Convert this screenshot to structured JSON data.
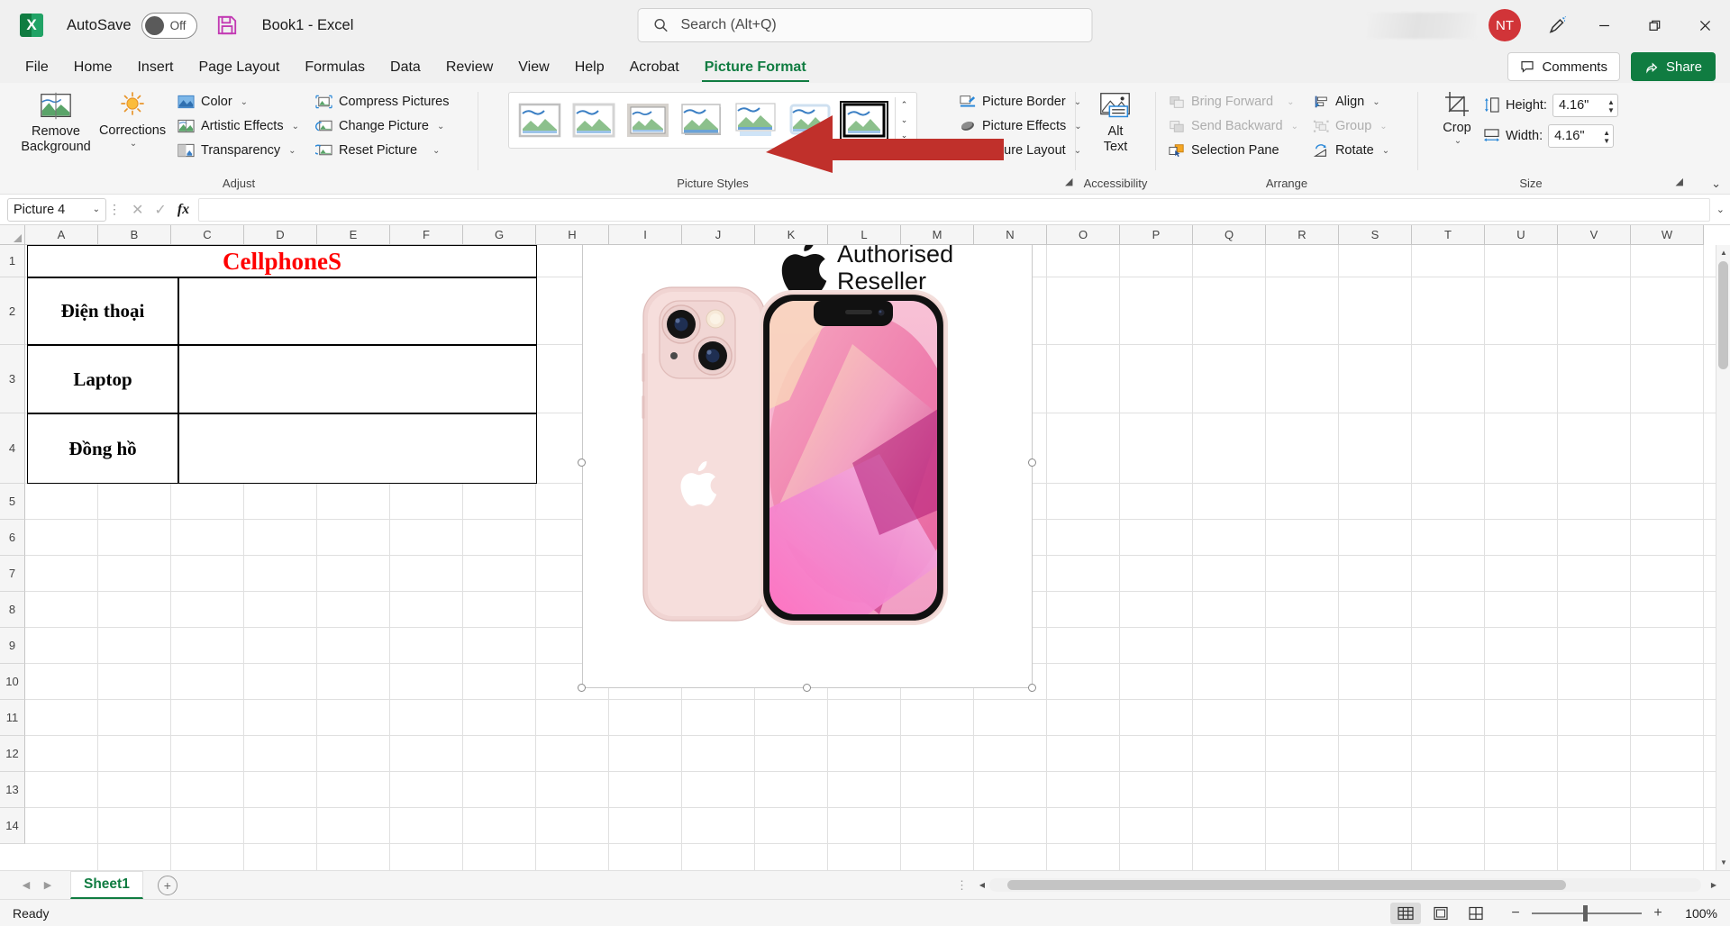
{
  "titlebar": {
    "app_icon": "excel-logo",
    "autosave_label": "AutoSave",
    "autosave_state": "Off",
    "save_icon": "save-icon",
    "document_title": "Book1  -  Excel",
    "search_placeholder": "Search (Alt+Q)",
    "avatar_initials": "NT",
    "avatar_color": "#d13438",
    "ink_icon": "pen-ink-icon",
    "minimize": "—",
    "restore": "❐",
    "close": "✕"
  },
  "tabs": {
    "items": [
      {
        "label": "File",
        "active": false
      },
      {
        "label": "Home",
        "active": false
      },
      {
        "label": "Insert",
        "active": false
      },
      {
        "label": "Page Layout",
        "active": false
      },
      {
        "label": "Formulas",
        "active": false
      },
      {
        "label": "Data",
        "active": false
      },
      {
        "label": "Review",
        "active": false
      },
      {
        "label": "View",
        "active": false
      },
      {
        "label": "Help",
        "active": false
      },
      {
        "label": "Acrobat",
        "active": false
      },
      {
        "label": "Picture Format",
        "active": true
      }
    ],
    "comments_label": "Comments",
    "share_label": "Share",
    "accent_color": "#107c41"
  },
  "ribbon": {
    "groups": [
      {
        "name": "Adjust",
        "label": "Adjust"
      },
      {
        "name": "Picture Styles",
        "label": "Picture Styles"
      },
      {
        "name": "Accessibility",
        "label": "Accessibility"
      },
      {
        "name": "Arrange",
        "label": "Arrange"
      },
      {
        "name": "Size",
        "label": "Size"
      }
    ],
    "adjust": {
      "remove_background": "Remove\nBackground",
      "remove_background_l1": "Remove",
      "remove_background_l2": "Background",
      "corrections": "Corrections",
      "color": "Color",
      "artistic_effects": "Artistic Effects",
      "transparency": "Transparency",
      "compress_pictures": "Compress Pictures",
      "change_picture": "Change Picture",
      "reset_picture": "Reset Picture"
    },
    "picture_styles": {
      "thumbnails": 7,
      "selected_index": 6,
      "scroll_up": "⌃",
      "scroll_down": "⌄",
      "more": "⌄"
    },
    "accessibility": {
      "alt_text_l1": "Alt",
      "alt_text_l2": "Text"
    },
    "arrange": {
      "bring_forward": "Bring Forward",
      "bring_forward_disabled": true,
      "send_backward": "Send Backward",
      "send_backward_disabled": true,
      "selection_pane": "Selection Pane",
      "align": "Align",
      "group": "Group",
      "group_disabled": true,
      "rotate": "Rotate"
    },
    "picture_side": {
      "picture_border": "Picture Border",
      "picture_effects": "Picture Effects",
      "picture_layout": "Picture Layout"
    },
    "size": {
      "crop": "Crop",
      "height_label": "Height:",
      "height_value": "4.16\"",
      "width_label": "Width:",
      "width_value": "4.16\""
    }
  },
  "formula_bar": {
    "name_box_value": "Picture 4",
    "cancel_icon": "✕",
    "enter_icon": "✓",
    "function_icon": "fx",
    "formula_value": "",
    "expand_icon": "⌄"
  },
  "grid": {
    "columns": [
      "A",
      "B",
      "C",
      "D",
      "E",
      "F",
      "G",
      "H",
      "I",
      "J",
      "K",
      "L",
      "M",
      "N",
      "O",
      "P",
      "Q",
      "R",
      "S",
      "T",
      "U",
      "V",
      "W"
    ],
    "rows": [
      "1",
      "2",
      "3",
      "4",
      "5",
      "6",
      "7",
      "8",
      "9",
      "10",
      "11",
      "12",
      "13",
      "14"
    ],
    "table": {
      "title": "CellphoneS",
      "title_color": "#ff0000",
      "labels": [
        "Điện thoại",
        "Laptop",
        "Đồng hồ"
      ]
    },
    "picture": {
      "name": "Picture 4",
      "selected": true,
      "badge_line1": "Authorised",
      "badge_line2": "Reseller",
      "product": "iPhone 13 pink"
    }
  },
  "sheetbar": {
    "prev_icon": "◀",
    "next_icon": "▶",
    "sheets": [
      {
        "label": "Sheet1",
        "active": true
      }
    ],
    "add_sheet_icon": "+"
  },
  "statusbar": {
    "status_text": "Ready",
    "view_normal": "normal-view-icon",
    "view_page_layout": "page-layout-view-icon",
    "view_page_break": "page-break-view-icon",
    "zoom_out": "−",
    "zoom_in": "+",
    "zoom_level": "100%"
  },
  "annotation": {
    "arrow_color": "#c0302b",
    "points_to": "Picture Format"
  }
}
